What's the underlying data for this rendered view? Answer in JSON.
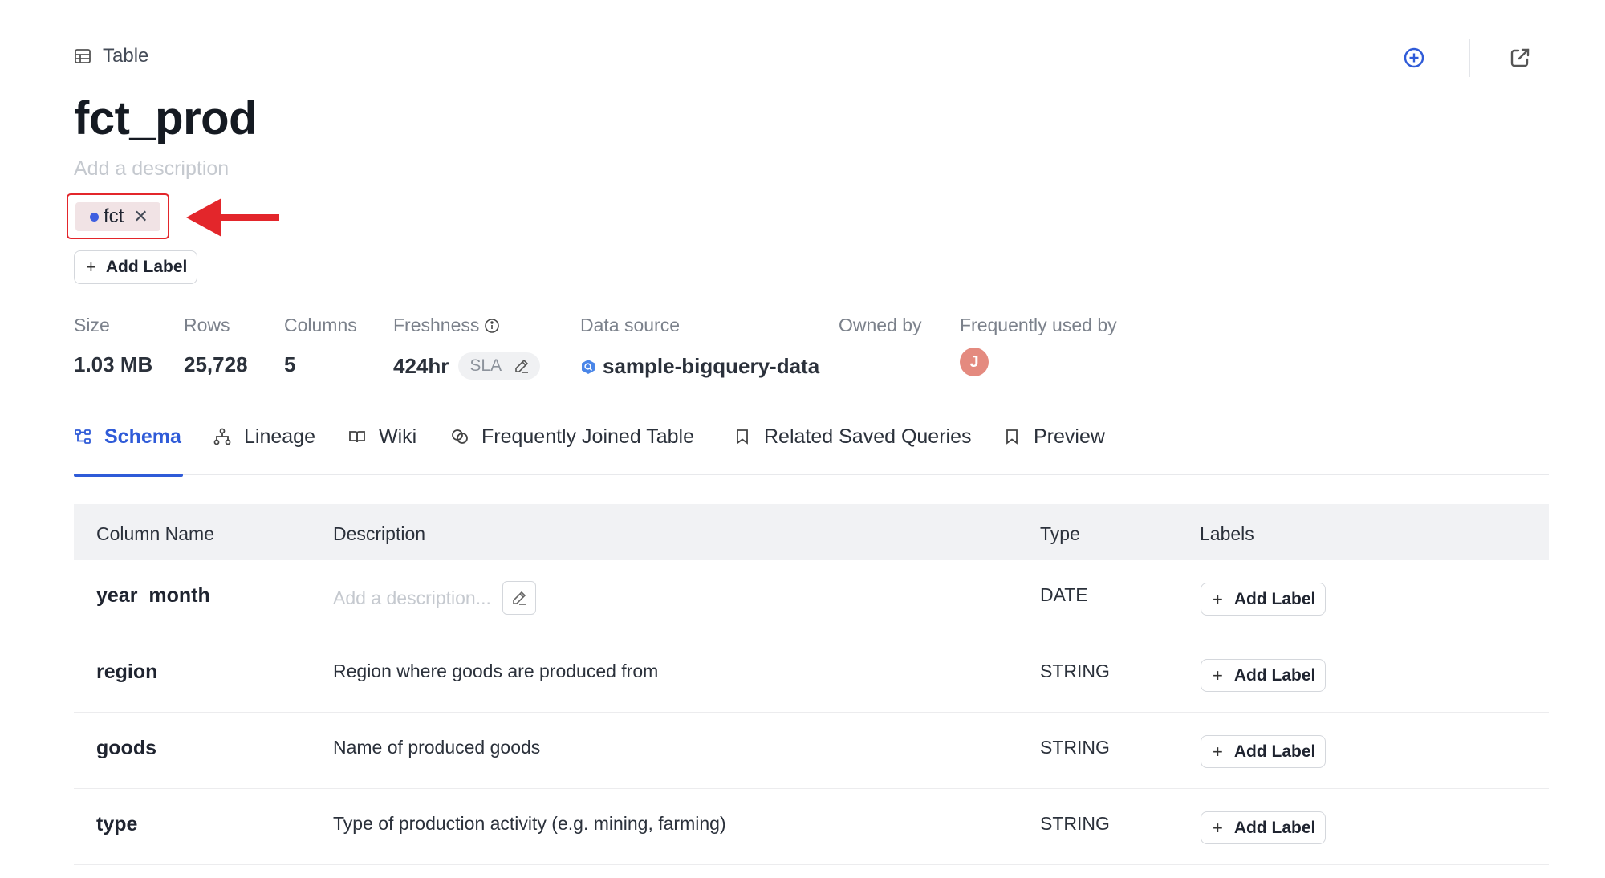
{
  "header": {
    "kind_label": "Table",
    "kind_icon": "table-icon",
    "title": "fct_prod",
    "description_placeholder": "Add a description"
  },
  "top_actions": {
    "add_icon": "plus-circle-icon",
    "open_icon": "external-link-icon"
  },
  "labels": [
    {
      "name": "fct",
      "color": "#3f5fe0"
    }
  ],
  "add_label_text": "Add Label",
  "stats": {
    "size": {
      "label": "Size",
      "value": "1.03 MB"
    },
    "rows": {
      "label": "Rows",
      "value": "25,728"
    },
    "columns": {
      "label": "Columns",
      "value": "5"
    },
    "freshness": {
      "label": "Freshness",
      "value": "424hr",
      "sla": "SLA"
    },
    "data_source": {
      "label": "Data source",
      "value": "sample-bigquery-data"
    },
    "owned_by": {
      "label": "Owned by"
    },
    "frequently_used_by": {
      "label": "Frequently used by",
      "avatar_initial": "J"
    }
  },
  "tabs": [
    {
      "label": "Schema",
      "icon": "schema-icon",
      "active": true
    },
    {
      "label": "Lineage",
      "icon": "lineage-icon"
    },
    {
      "label": "Wiki",
      "icon": "book-icon"
    },
    {
      "label": "Frequently Joined Table",
      "icon": "join-icon"
    },
    {
      "label": "Related Saved Queries",
      "icon": "bookmark-icon"
    },
    {
      "label": "Preview",
      "icon": "bookmark-icon"
    }
  ],
  "schema": {
    "headers": {
      "name": "Column Name",
      "description": "Description",
      "type": "Type",
      "labels": "Labels"
    },
    "rows": [
      {
        "name": "year_month",
        "description": "",
        "description_placeholder": "Add a description...",
        "type": "DATE"
      },
      {
        "name": "region",
        "description": "Region where goods are produced from",
        "type": "STRING"
      },
      {
        "name": "goods",
        "description": "Name of produced goods",
        "type": "STRING"
      },
      {
        "name": "type",
        "description": "Type of production activity (e.g. mining, farming)",
        "type": "STRING"
      }
    ]
  },
  "colors": {
    "accent": "#2f5bd8",
    "highlight_box": "#e3262b",
    "arrow": "#e3262b",
    "avatar": "#e48a7f"
  }
}
